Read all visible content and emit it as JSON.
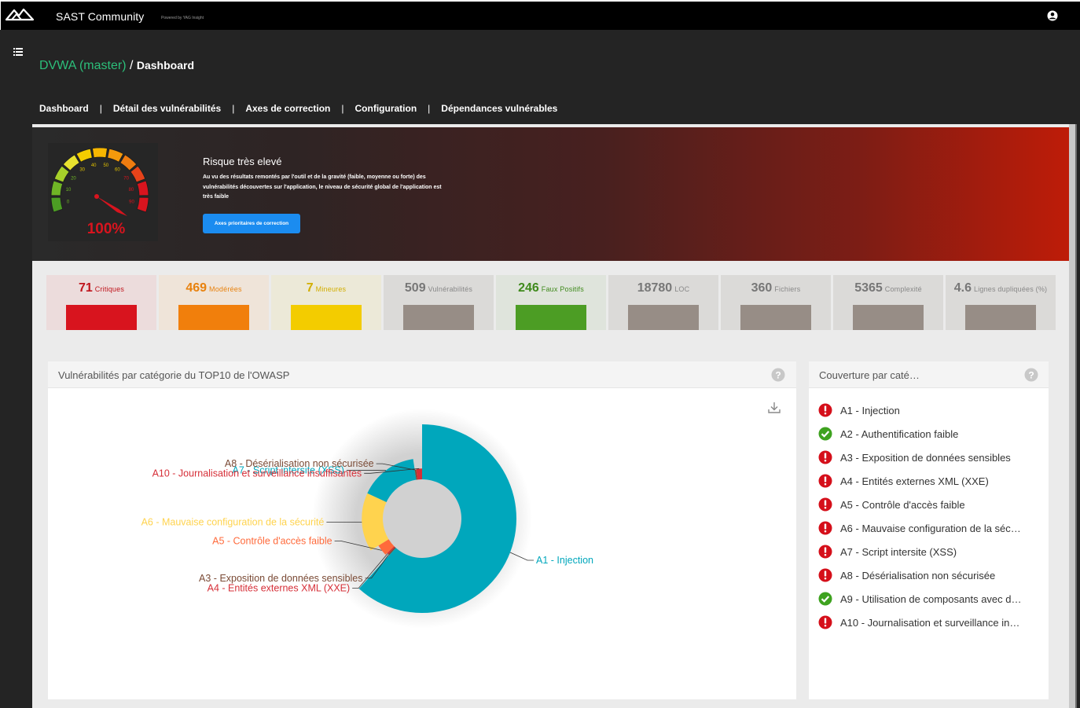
{
  "app": {
    "name": "SAST Community",
    "powered_by": "Powered by YAG Insight"
  },
  "breadcrumb": {
    "project": "DVWA (master)",
    "separator": " / ",
    "page": "Dashboard"
  },
  "nav": {
    "items": [
      "Dashboard",
      "Détail des vulnérabilités",
      "Axes de correction",
      "Configuration",
      "Dépendances vulnérables"
    ],
    "separator": "|"
  },
  "hero": {
    "gauge_value": "100%",
    "gauge_ticks": [
      "0",
      "10",
      "20",
      "30",
      "40",
      "50",
      "60",
      "70",
      "80",
      "90"
    ],
    "risk_title": "Risque très elevé",
    "risk_description": "Au vu des résultats remontés par l'outil et de la gravité (faible, moyenne ou forte) des vulnérabilités découvertes sur l'application, le niveau de sécurité global de l'application est très faible",
    "button_label": "Axes prioritaires de correction"
  },
  "stats": [
    {
      "value": "71",
      "label": "Critiques",
      "color": "#d8141e",
      "bg": "#ecdcdc",
      "num_color": "#c0151d",
      "lbl_color": "#c0151d"
    },
    {
      "value": "469",
      "label": "Modérées",
      "color": "#f17f0c",
      "bg": "#efe4d9",
      "num_color": "#e8820f",
      "lbl_color": "#e8820f"
    },
    {
      "value": "7",
      "label": "Mineures",
      "color": "#f3cc00",
      "bg": "#ece9d8",
      "num_color": "#d2ae00",
      "lbl_color": "#d2ae00"
    },
    {
      "value": "509",
      "label": "Vulnérabilités",
      "color": "#978d86",
      "bg": "#dbdad8",
      "num_color": "#777",
      "lbl_color": "#888"
    },
    {
      "value": "246",
      "label": "Faux Positifs",
      "color": "#4c9d24",
      "bg": "#dfe4dc",
      "num_color": "#3f8a1c",
      "lbl_color": "#3f8a1c"
    },
    {
      "value": "18780",
      "label": "LOC",
      "color": "#978d86",
      "bg": "#dbdad8",
      "num_color": "#777",
      "lbl_color": "#888"
    },
    {
      "value": "360",
      "label": "Fichiers",
      "color": "#978d86",
      "bg": "#dbdad8",
      "num_color": "#777",
      "lbl_color": "#888"
    },
    {
      "value": "5365",
      "label": "Complexité",
      "color": "#978d86",
      "bg": "#dbdad8",
      "num_color": "#777",
      "lbl_color": "#888"
    },
    {
      "value": "4.6",
      "label": "Lignes dupliquées (%)",
      "color": "#978d86",
      "bg": "#dbdad8",
      "num_color": "#777",
      "lbl_color": "#888"
    }
  ],
  "owasp_panel": {
    "title": "Vulnérabilités par catégorie du TOP10 de l'OWASP"
  },
  "coverage_panel": {
    "title": "Couverture par caté…",
    "items": [
      {
        "label": "A1 - Injection",
        "status": "error"
      },
      {
        "label": "A2 - Authentification faible",
        "status": "ok"
      },
      {
        "label": "A3 - Exposition de données sensibles",
        "status": "error"
      },
      {
        "label": "A4 - Entités externes XML (XXE)",
        "status": "error"
      },
      {
        "label": "A5 - Contrôle d'accès faible",
        "status": "error"
      },
      {
        "label": "A6 - Mauvaise configuration de la séc…",
        "status": "error"
      },
      {
        "label": "A7 - Script intersite (XSS)",
        "status": "error"
      },
      {
        "label": "A8 - Désérialisation non sécurisée",
        "status": "error"
      },
      {
        "label": "A9 - Utilisation de composants avec d…",
        "status": "ok"
      },
      {
        "label": "A10 - Journalisation et surveillance in…",
        "status": "error"
      }
    ]
  },
  "chart_data": {
    "type": "pie",
    "title": "",
    "variant": "donut",
    "slices": [
      {
        "label": "A1 - Injection",
        "value": 259,
        "color": "#00a7bc"
      },
      {
        "label": "A3 - Exposition de données sensibles",
        "value": 2,
        "color": "#7a4a35"
      },
      {
        "label": "A4 - Entités externes XML (XXE)",
        "value": 2,
        "color": "#d62f38"
      },
      {
        "label": "A5 - Contrôle d'accès faible",
        "value": 15,
        "color": "#ff6a3b"
      },
      {
        "label": "A6 - Mauvaise configuration de la sécurité",
        "value": 66,
        "color": "#ffd34e"
      },
      {
        "label": "A7 - Script intersite (XSS)",
        "value": 66,
        "color": "#00a7bc"
      },
      {
        "label": "A8 - Désérialisation non sécurisée",
        "value": 2,
        "color": "#7a4a35"
      },
      {
        "label": "A10 - Journalisation et surveillance insuffisantes",
        "value": 8,
        "color": "#d62f38"
      }
    ],
    "label_colors": {
      "A1 - Injection": "#00a7bc",
      "A3 - Exposition de données sensibles": "#7a4a35",
      "A4 - Entités externes XML (XXE)": "#d62f38",
      "A5 - Contrôle d'accès faible": "#ff6a3b",
      "A6 - Mauvaise configuration de la sécurité": "#ffd34e",
      "A7 - Script intersite (XSS)": "#00a7bc",
      "A8 - Désérialisation non sécurisée": "#7a4a35",
      "A10 - Journalisation et surveillance insuffisantes": "#d62f38"
    }
  }
}
